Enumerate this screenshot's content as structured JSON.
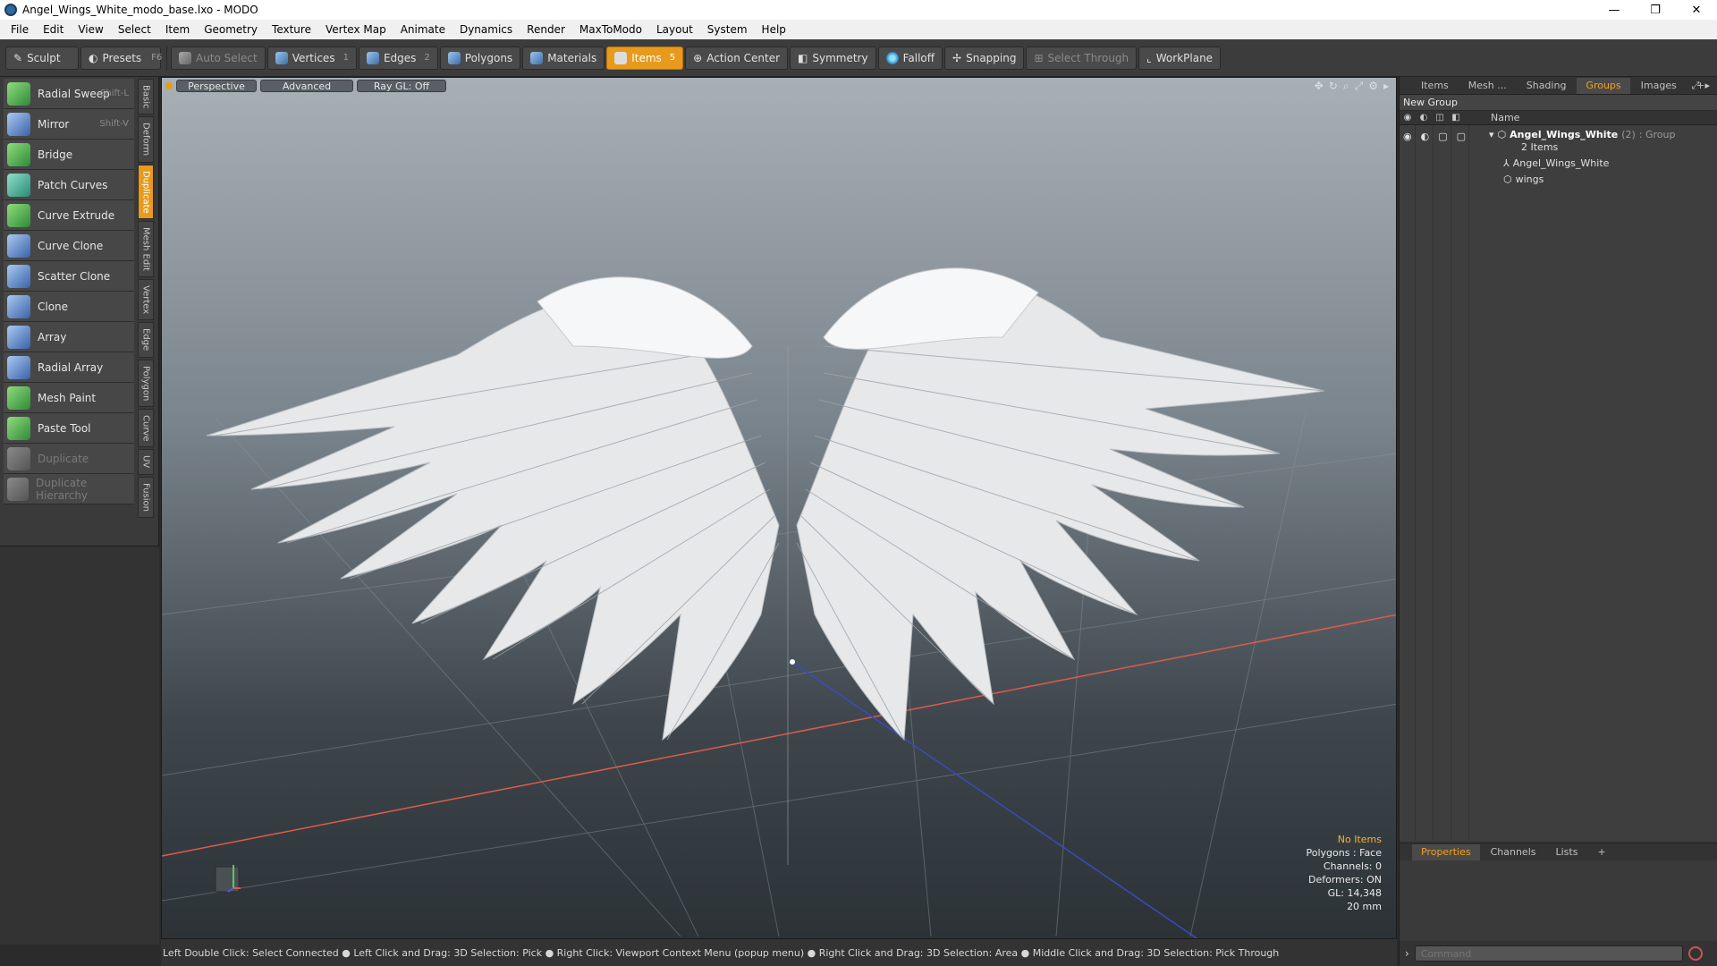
{
  "window": {
    "title": "Angel_Wings_White_modo_base.lxo - MODO",
    "minimize": "—",
    "maximize": "❐",
    "close": "✕"
  },
  "menu": [
    "File",
    "Edit",
    "View",
    "Select",
    "Item",
    "Geometry",
    "Texture",
    "Vertex Map",
    "Animate",
    "Dynamics",
    "Render",
    "MaxToModo",
    "Layout",
    "System",
    "Help"
  ],
  "toolbar": {
    "sculpt": "Sculpt",
    "presets": "Presets",
    "presets_key": "F6",
    "auto_select": "Auto Select",
    "vertices": "Vertices",
    "vertices_num": "1",
    "edges": "Edges",
    "edges_num": "2",
    "polygons": "Polygons",
    "materials": "Materials",
    "items": "Items",
    "items_num": "5",
    "action_center": "Action Center",
    "symmetry": "Symmetry",
    "falloff": "Falloff",
    "snapping": "Snapping",
    "select_through": "Select Through",
    "workplane": "WorkPlane"
  },
  "tools": [
    {
      "label": "Radial Sweep",
      "key": "Shift-L"
    },
    {
      "label": "Mirror",
      "key": "Shift-V"
    },
    {
      "label": "Bridge",
      "key": ""
    },
    {
      "label": "Patch Curves",
      "key": ""
    },
    {
      "label": "Curve Extrude",
      "key": ""
    },
    {
      "label": "Curve Clone",
      "key": ""
    },
    {
      "label": "Scatter Clone",
      "key": ""
    },
    {
      "label": "Clone",
      "key": ""
    },
    {
      "label": "Array",
      "key": ""
    },
    {
      "label": "Radial Array",
      "key": ""
    },
    {
      "label": "Mesh Paint",
      "key": ""
    },
    {
      "label": "Paste Tool",
      "key": ""
    },
    {
      "label": "Duplicate",
      "key": ""
    },
    {
      "label": "Duplicate Hierarchy",
      "key": ""
    }
  ],
  "vtabs": [
    "Basic",
    "Deform",
    "Duplicate",
    "Mesh Edit",
    "Vertex",
    "Edge",
    "Polygon",
    "Curve",
    "UV",
    "Fusion"
  ],
  "viewport": {
    "perspective": "Perspective",
    "advanced": "Advanced",
    "raygl": "Ray GL: Off",
    "info": {
      "no_items": "No Items",
      "polygons": "Polygons : Face",
      "channels": "Channels: 0",
      "deformers": "Deformers: ON",
      "gl": "GL: 14,348",
      "size": "20 mm"
    }
  },
  "status": "Left Double Click: Select Connected ● Left Click and Drag: 3D Selection: Pick ● Right Click: Viewport Context Menu (popup menu) ● Right Click and Drag: 3D Selection: Area ● Middle Click and Drag: 3D Selection: Pick Through",
  "right_panel": {
    "tabs": [
      "Items",
      "Mesh ...",
      "Shading",
      "Groups",
      "Images"
    ],
    "new_group": "New Group",
    "name_header": "Name",
    "group_name": "Angel_Wings_White",
    "group_count": "(2)",
    "group_type": ": Group",
    "group_items": "2 Items",
    "child1": "Angel_Wings_White",
    "child2": "wings",
    "props_tabs": [
      "Properties",
      "Channels",
      "Lists"
    ],
    "command_placeholder": "Command"
  }
}
